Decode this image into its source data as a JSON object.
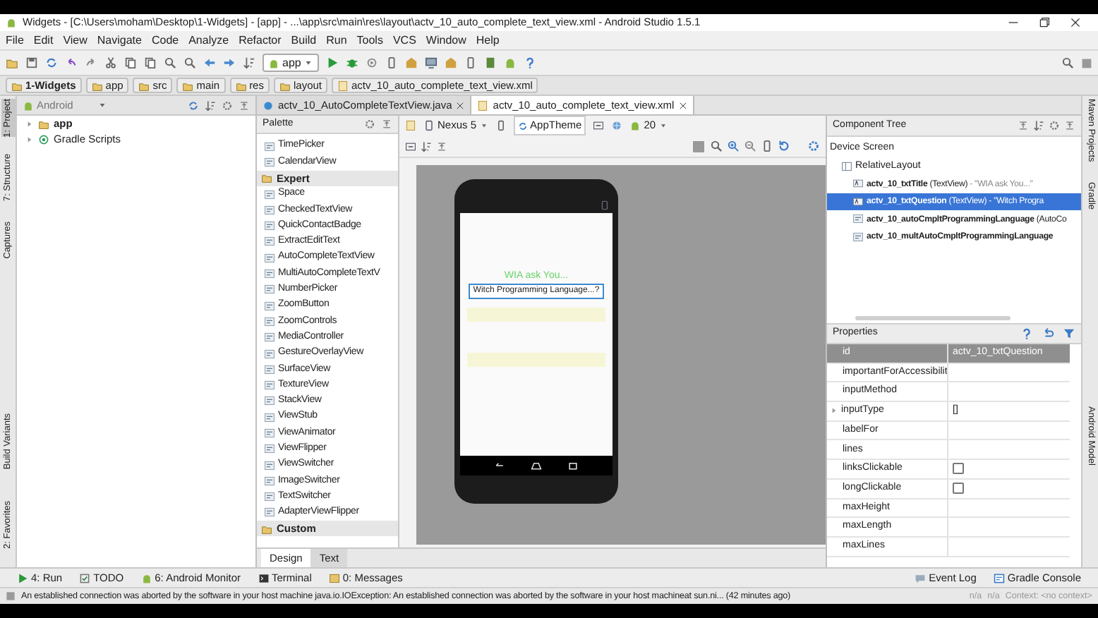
{
  "window": {
    "title": "Widgets - [C:\\Users\\moham\\Desktop\\1-Widgets] - [app] - ...\\app\\src\\main\\res\\layout\\actv_10_auto_complete_text_view.xml - Android Studio 1.5.1"
  },
  "menu": [
    "File",
    "Edit",
    "View",
    "Navigate",
    "Code",
    "Analyze",
    "Refactor",
    "Build",
    "Run",
    "Tools",
    "VCS",
    "Window",
    "Help"
  ],
  "toolbar": {
    "run_config": "app"
  },
  "breadcrumb": [
    {
      "label": "1-Widgets",
      "kind": "project"
    },
    {
      "label": "app",
      "kind": "module"
    },
    {
      "label": "src",
      "kind": "folder"
    },
    {
      "label": "main",
      "kind": "folder"
    },
    {
      "label": "res",
      "kind": "folder"
    },
    {
      "label": "layout",
      "kind": "folder"
    },
    {
      "label": "actv_10_auto_complete_text_view.xml",
      "kind": "xml"
    }
  ],
  "left_tool_windows": [
    {
      "label": "1: Project",
      "selected": true
    },
    {
      "label": "7: Structure",
      "selected": false
    },
    {
      "label": "Captures",
      "selected": false
    },
    {
      "label": "Build Variants",
      "selected": false
    },
    {
      "label": "2: Favorites",
      "selected": false
    }
  ],
  "right_tool_windows": [
    {
      "label": "Maven Projects"
    },
    {
      "label": "Gradle"
    },
    {
      "label": "Android Model"
    }
  ],
  "project": {
    "view": "Android",
    "tree": [
      {
        "label": "app",
        "kind": "module",
        "expanded": false
      },
      {
        "label": "Gradle Scripts",
        "kind": "gradle",
        "expanded": false
      }
    ]
  },
  "editor_tabs": [
    {
      "label": "actv_10_AutoCompleteTextView.java",
      "kind": "java",
      "selected": false
    },
    {
      "label": "actv_10_auto_complete_text_view.xml",
      "kind": "xml",
      "selected": true
    }
  ],
  "palette": {
    "title": "Palette",
    "items": [
      {
        "kind": "item",
        "label": "TimePicker"
      },
      {
        "kind": "item",
        "label": "CalendarView"
      },
      {
        "kind": "section",
        "label": "Expert"
      },
      {
        "kind": "item",
        "label": "Space"
      },
      {
        "kind": "item",
        "label": "CheckedTextView"
      },
      {
        "kind": "item",
        "label": "QuickContactBadge"
      },
      {
        "kind": "item",
        "label": "ExtractEditText"
      },
      {
        "kind": "item",
        "label": "AutoCompleteTextView"
      },
      {
        "kind": "item",
        "label": "MultiAutoCompleteTextV"
      },
      {
        "kind": "item",
        "label": "NumberPicker"
      },
      {
        "kind": "item",
        "label": "ZoomButton"
      },
      {
        "kind": "item",
        "label": "ZoomControls"
      },
      {
        "kind": "item",
        "label": "MediaController"
      },
      {
        "kind": "item",
        "label": "GestureOverlayView"
      },
      {
        "kind": "item",
        "label": "SurfaceView"
      },
      {
        "kind": "item",
        "label": "TextureView"
      },
      {
        "kind": "item",
        "label": "StackView"
      },
      {
        "kind": "item",
        "label": "ViewStub"
      },
      {
        "kind": "item",
        "label": "ViewAnimator"
      },
      {
        "kind": "item",
        "label": "ViewFlipper"
      },
      {
        "kind": "item",
        "label": "ViewSwitcher"
      },
      {
        "kind": "item",
        "label": "ImageSwitcher"
      },
      {
        "kind": "item",
        "label": "TextSwitcher"
      },
      {
        "kind": "item",
        "label": "AdapterViewFlipper"
      },
      {
        "kind": "section",
        "label": "Custom"
      }
    ]
  },
  "designer": {
    "device": "Nexus 5",
    "theme": "AppTheme",
    "api": "20",
    "preview": {
      "title": "WIA ask You...",
      "question": "Witch Programming Language...?"
    }
  },
  "bottom_tabs": [
    {
      "label": "Design",
      "selected": true
    },
    {
      "label": "Text",
      "selected": false
    }
  ],
  "component_tree": {
    "title": "Component Tree",
    "nodes": [
      {
        "label": "Device Screen",
        "children": [
          {
            "label": "RelativeLayout",
            "children": [
              {
                "id": "actv_10_txtTitle",
                "type": "(TextView)",
                "text": "- \"WIA ask You...\"",
                "kind": "text",
                "selected": false
              },
              {
                "id": "actv_10_txtQuestion",
                "type": "(TextView)",
                "text": "- \"Witch Progra",
                "kind": "text",
                "selected": true
              },
              {
                "id": "actv_10_autoCmpltProgrammingLanguage",
                "type": "(AutoCo",
                "kind": "auto",
                "selected": false
              },
              {
                "id": "actv_10_multAutoCmpltProgrammingLanguage",
                "kind": "auto",
                "selected": false
              }
            ]
          }
        ]
      }
    ]
  },
  "properties": {
    "title": "Properties",
    "rows": [
      {
        "name": "id",
        "value": "actv_10_txtQuestion",
        "kind": "header"
      },
      {
        "name": "importantForAccessibilit",
        "kind": "text"
      },
      {
        "name": "inputMethod",
        "kind": "text"
      },
      {
        "name": "inputType",
        "value": "[]",
        "kind": "group"
      },
      {
        "name": "labelFor",
        "kind": "text"
      },
      {
        "name": "lines",
        "kind": "text"
      },
      {
        "name": "linksClickable",
        "kind": "checkbox",
        "checked": false
      },
      {
        "name": "longClickable",
        "kind": "checkbox",
        "checked": false
      },
      {
        "name": "maxHeight",
        "kind": "text"
      },
      {
        "name": "maxLength",
        "kind": "text"
      },
      {
        "name": "maxLines",
        "kind": "text"
      }
    ]
  },
  "bottom_tool_windows": [
    {
      "label": "4: Run",
      "kind": "run"
    },
    {
      "label": "TODO",
      "kind": "todo"
    },
    {
      "label": "6: Android Monitor",
      "kind": "android"
    },
    {
      "label": "Terminal",
      "kind": "terminal"
    },
    {
      "label": "0: Messages",
      "kind": "messages"
    }
  ],
  "bottom_tool_windows_right": [
    {
      "label": "Event Log",
      "kind": "log"
    },
    {
      "label": "Gradle Console",
      "kind": "console"
    }
  ],
  "status": {
    "message": "An established connection was aborted by the software in your host machine java.io.IOException: An established connection was aborted by the software in your host machineat sun.ni... (42 minutes ago)",
    "fields": [
      "n/a",
      "n/a",
      "Context: <no context>"
    ]
  }
}
